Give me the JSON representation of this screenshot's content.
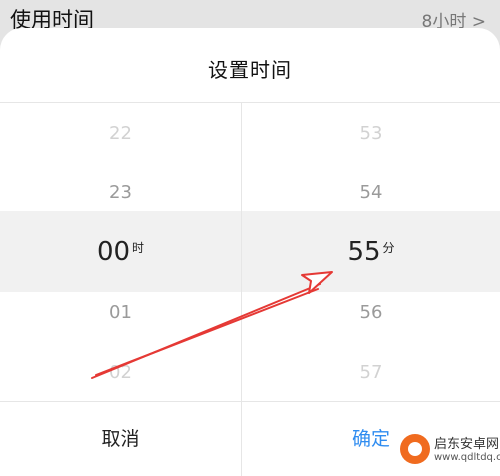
{
  "background_row": {
    "label": "使用时间",
    "value": "8小时 >"
  },
  "dialog": {
    "title": "设置时间",
    "hour_wheel": {
      "items": [
        "22",
        "23",
        "00",
        "01",
        "02"
      ],
      "selected": "00",
      "unit": "时"
    },
    "minute_wheel": {
      "items": [
        "53",
        "54",
        "55",
        "56",
        "57"
      ],
      "selected": "55",
      "unit": "分"
    },
    "buttons": {
      "cancel": "取消",
      "confirm": "确定"
    }
  },
  "annotation": {
    "color": "#e53935",
    "icon": "red-arrow-icon"
  },
  "watermark": {
    "icon": "watermark-logo-icon",
    "text": "启东安卓网",
    "url": "www.qdltdq.com"
  },
  "colors": {
    "accent": "#2f8cf0",
    "selected_band": "#f1f1f1"
  }
}
